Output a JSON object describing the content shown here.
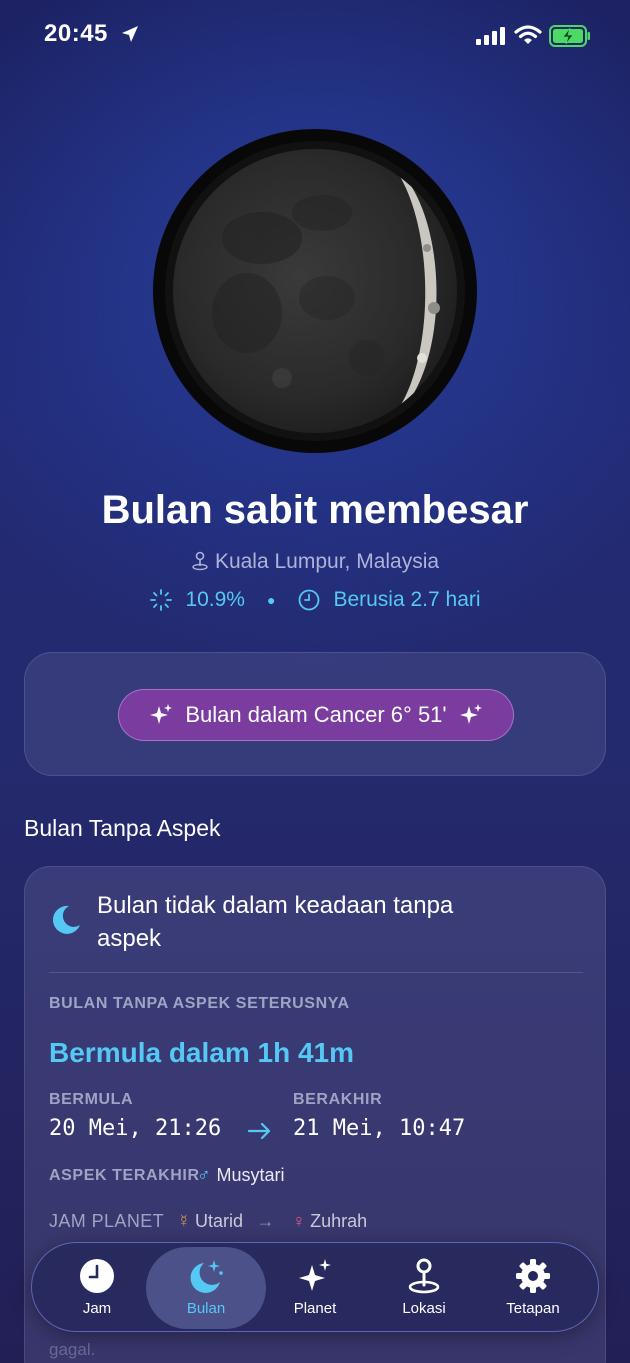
{
  "status_bar": {
    "time": "20:45"
  },
  "moon": {
    "phase_name": "Bulan sabit membesar",
    "location": "Kuala Lumpur, Malaysia",
    "illumination": "10.9%",
    "age": "Berusia 2.7 hari"
  },
  "sign": {
    "label": "Bulan dalam Cancer 6° 51'"
  },
  "void_of_course": {
    "section_title": "Bulan Tanpa Aspek",
    "status": "Bulan tidak dalam keadaan tanpa aspek",
    "next_label": "BULAN TANPA ASPEK SETERUSNYA",
    "next_start": "Bermula dalam 1h 41m",
    "start_label": "BERMULA",
    "start_value": "20 Mei, 21:26",
    "end_label": "BERAKHIR",
    "end_value": "21 Mei, 10:47",
    "last_aspect_label": "ASPEK TERAKHIR",
    "last_aspect_symbol": "♂",
    "last_aspect_planet": "Musytari",
    "planet_hours_label": "JAM PLANET",
    "planet_hour_current_symbol": "☿",
    "planet_hour_current": "Utarid",
    "planet_hour_next_symbol": "♀",
    "planet_hour_next": "Zuhrah",
    "faded_text": "gagal."
  },
  "tabs": [
    {
      "label": "Jam",
      "icon": "clock-icon"
    },
    {
      "label": "Bulan",
      "icon": "moon-stars-icon",
      "active": true
    },
    {
      "label": "Planet",
      "icon": "sparkles-icon"
    },
    {
      "label": "Lokasi",
      "icon": "location-pin-icon"
    },
    {
      "label": "Tetapan",
      "icon": "gear-icon"
    }
  ],
  "colors": {
    "accent": "#55c8f3",
    "pill": "#7a3c9e",
    "tab_border": "#8c96ff"
  }
}
